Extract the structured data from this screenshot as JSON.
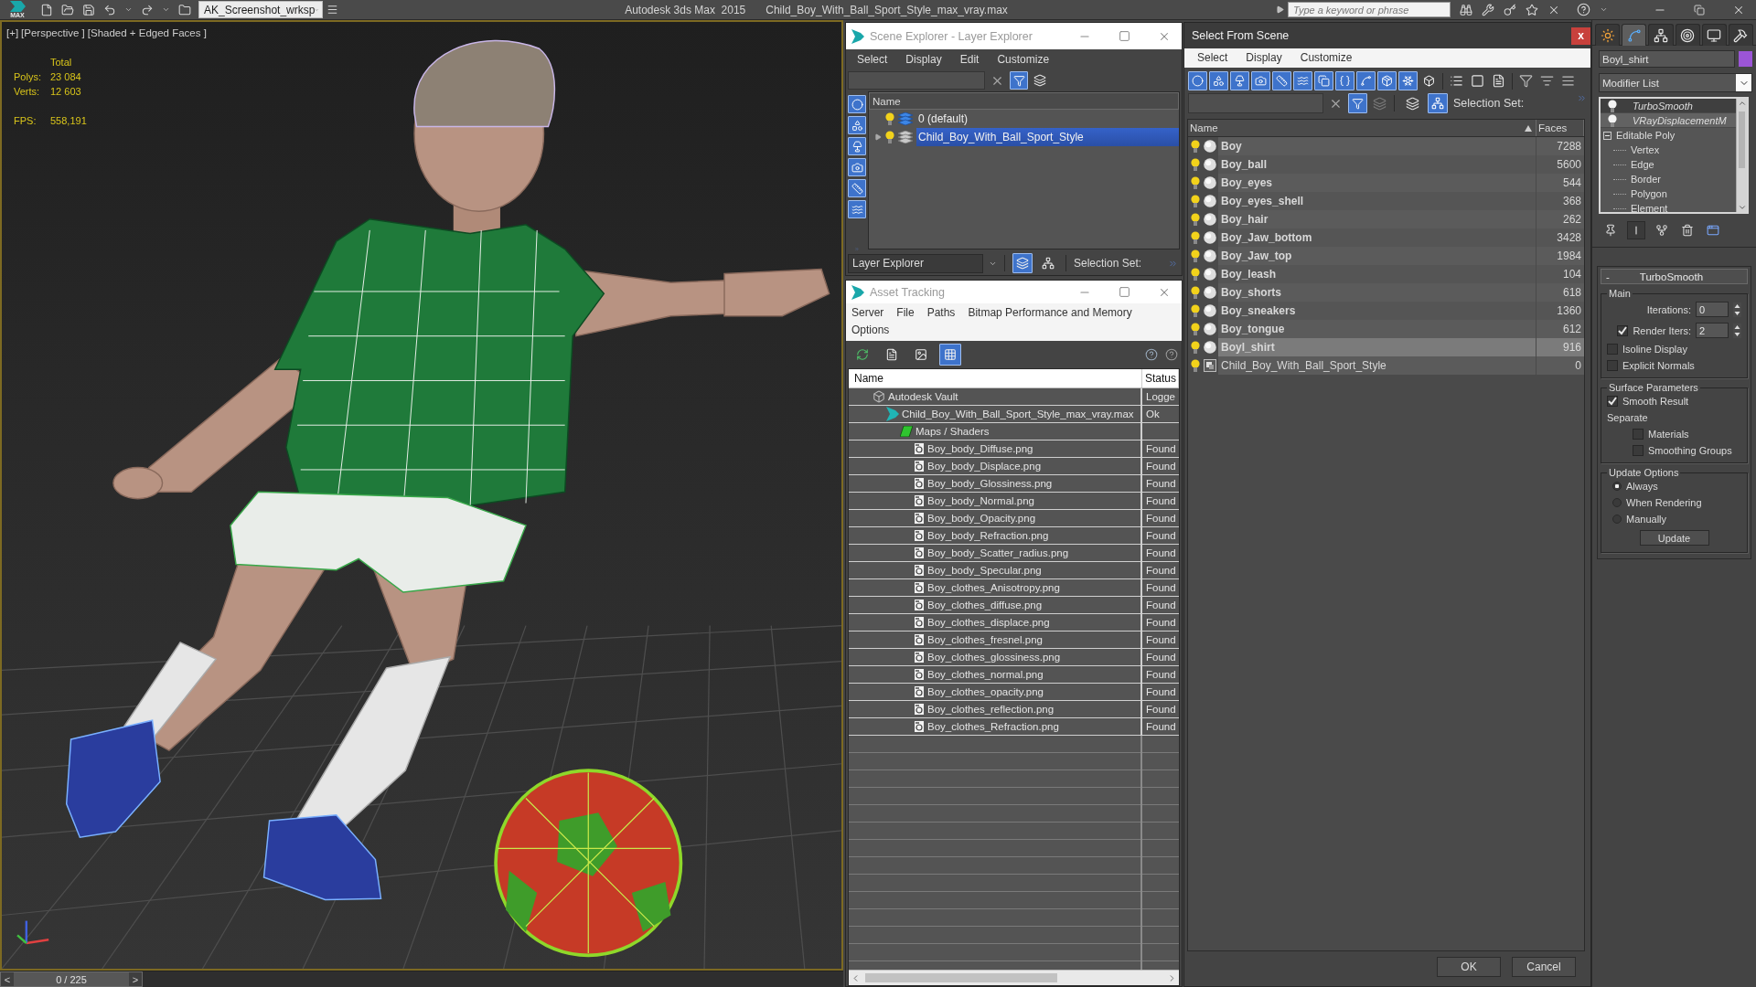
{
  "title_bar": {
    "logo": "MAX",
    "workspace": "AK_Screenshot_wrksp",
    "app_title": "Autodesk 3ds Max  2015",
    "file_title": "Child_Boy_With_Ball_Sport_Style_max_vray.max",
    "search": {
      "placeholder": "Type a keyword or phrase"
    }
  },
  "viewport": {
    "labels": [
      "[+]",
      "[Perspective ]",
      "[Shaded + Edged Faces ]"
    ],
    "stats_heading": "Total",
    "counts": [
      {
        "label": "Polys:",
        "value": "23 084"
      },
      {
        "label": "Verts:",
        "value": "12 603"
      }
    ],
    "fps": {
      "label": "FPS:",
      "value": "558,191"
    }
  },
  "timeline": {
    "previous": "<",
    "frame": "0 / 225",
    "next": ">",
    "level": 0
  },
  "scene_explorer": {
    "title": "Scene Explorer - Layer Explorer",
    "menu": [
      "Select",
      "Display",
      "Edit",
      "Customize"
    ],
    "filter_active": true,
    "type_filters": [
      {
        "on": true
      },
      {
        "on": true
      },
      {
        "on": true
      },
      {
        "on": true
      },
      {
        "on": true
      },
      {
        "on": true
      }
    ],
    "column": "Name",
    "layers": [
      {
        "name": "0 (default)",
        "current": true,
        "expandable": false,
        "selected": false
      },
      {
        "name": "Child_Boy_With_Ball_Sport_Style",
        "current": false,
        "expandable": true,
        "selected": true
      }
    ],
    "mode": "Layer Explorer",
    "view_buttons": [
      {
        "selected": true
      },
      {
        "selected": false
      }
    ],
    "selection_set": "Selection Set:"
  },
  "asset_tracking": {
    "title": "Asset Tracking",
    "menu": [
      "Server",
      "File",
      "Paths",
      "Bitmap Performance and Memory",
      "Options"
    ],
    "view_buttons": [
      {
        "selected": false
      },
      {
        "selected": false
      },
      {
        "selected": false
      },
      {
        "selected": true
      }
    ],
    "columns": [
      "Name",
      "Status"
    ],
    "assets": [
      {
        "kind": "vault",
        "name": "Autodesk Vault",
        "status": "Logge",
        "children": [
          {
            "kind": "scene",
            "name": "Child_Boy_With_Ball_Sport_Style_max_vray.max",
            "status": "Ok",
            "children": [
              {
                "kind": "folder",
                "name": "Maps / Shaders",
                "children": [
                  {
                    "kind": "bitmap",
                    "name": "Boy_body_Diffuse.png",
                    "status": "Found"
                  },
                  {
                    "kind": "bitmap",
                    "name": "Boy_body_Displace.png",
                    "status": "Found"
                  },
                  {
                    "kind": "bitmap",
                    "name": "Boy_body_Glossiness.png",
                    "status": "Found"
                  },
                  {
                    "kind": "bitmap",
                    "name": "Boy_body_Normal.png",
                    "status": "Found"
                  },
                  {
                    "kind": "bitmap",
                    "name": "Boy_body_Opacity.png",
                    "status": "Found"
                  },
                  {
                    "kind": "bitmap",
                    "name": "Boy_body_Refraction.png",
                    "status": "Found"
                  },
                  {
                    "kind": "bitmap",
                    "name": "Boy_body_Scatter_radius.png",
                    "status": "Found"
                  },
                  {
                    "kind": "bitmap",
                    "name": "Boy_body_Specular.png",
                    "status": "Found"
                  },
                  {
                    "kind": "bitmap",
                    "name": "Boy_clothes_Anisotropy.png",
                    "status": "Found"
                  },
                  {
                    "kind": "bitmap",
                    "name": "Boy_clothes_diffuse.png",
                    "status": "Found"
                  },
                  {
                    "kind": "bitmap",
                    "name": "Boy_clothes_displace.png",
                    "status": "Found"
                  },
                  {
                    "kind": "bitmap",
                    "name": "Boy_clothes_fresnel.png",
                    "status": "Found"
                  },
                  {
                    "kind": "bitmap",
                    "name": "Boy_clothes_glossiness.png",
                    "status": "Found"
                  },
                  {
                    "kind": "bitmap",
                    "name": "Boy_clothes_normal.png",
                    "status": "Found"
                  },
                  {
                    "kind": "bitmap",
                    "name": "Boy_clothes_opacity.png",
                    "status": "Found"
                  },
                  {
                    "kind": "bitmap",
                    "name": "Boy_clothes_reflection.png",
                    "status": "Found"
                  },
                  {
                    "kind": "bitmap",
                    "name": "Boy_clothes_Refraction.png",
                    "status": "Found"
                  }
                ]
              }
            ]
          }
        ]
      }
    ]
  },
  "select_from_scene": {
    "title": "Select From Scene",
    "close": "x",
    "menu": [
      "Select",
      "Display",
      "Customize"
    ],
    "type_filters": [
      {
        "on": true
      },
      {
        "on": true
      },
      {
        "on": true
      },
      {
        "on": true
      },
      {
        "on": true
      },
      {
        "on": true
      },
      {
        "on": true
      },
      {
        "on": true
      },
      {
        "on": true
      },
      {
        "on": true
      },
      {
        "on": true
      },
      {
        "on": false
      }
    ],
    "filter_active": true,
    "view_buttons": [
      {
        "selected": false
      },
      {
        "selected": true
      }
    ],
    "selection_set": "Selection Set:",
    "columns": [
      "Name",
      "Faces"
    ],
    "objects": [
      {
        "kind": "geometry",
        "name": "Boy",
        "faces": "7288",
        "selected": false
      },
      {
        "kind": "geometry",
        "name": "Boy_ball",
        "faces": "5600",
        "selected": false
      },
      {
        "kind": "geometry",
        "name": "Boy_eyes",
        "faces": "544",
        "selected": false
      },
      {
        "kind": "geometry",
        "name": "Boy_eyes_shell",
        "faces": "368",
        "selected": false
      },
      {
        "kind": "geometry",
        "name": "Boy_hair",
        "faces": "262",
        "selected": false
      },
      {
        "kind": "geometry",
        "name": "Boy_Jaw_bottom",
        "faces": "3428",
        "selected": false
      },
      {
        "kind": "geometry",
        "name": "Boy_Jaw_top",
        "faces": "1984",
        "selected": false
      },
      {
        "kind": "geometry",
        "name": "Boy_leash",
        "faces": "104",
        "selected": false
      },
      {
        "kind": "geometry",
        "name": "Boy_shorts",
        "faces": "618",
        "selected": false
      },
      {
        "kind": "geometry",
        "name": "Boy_sneakers",
        "faces": "1360",
        "selected": false
      },
      {
        "kind": "geometry",
        "name": "Boy_tongue",
        "faces": "612",
        "selected": false
      },
      {
        "kind": "geometry",
        "name": "Boyl_shirt",
        "faces": "916",
        "selected": true
      },
      {
        "kind": "group",
        "name": "Child_Boy_With_Ball_Sport_Style",
        "faces": "0",
        "selected": false
      }
    ],
    "buttons": [
      "OK",
      "Cancel"
    ]
  },
  "command_panel": {
    "tabs": [
      {
        "selected": false
      },
      {
        "selected": true
      },
      {
        "selected": false
      },
      {
        "selected": false
      },
      {
        "selected": false
      },
      {
        "selected": false
      }
    ],
    "object": {
      "name": "Boyl_shirt",
      "color": "#9b55d6"
    },
    "modifier_list": "Modifier List",
    "stack": [
      {
        "kind": "modifier",
        "name": "TurboSmooth",
        "selected": true
      },
      {
        "kind": "modifier",
        "name": "VRayDisplacementM",
        "selected": false
      },
      {
        "kind": "base",
        "name": "Editable Poly",
        "selected": false,
        "expanded": true,
        "children": [
          {
            "name": "Vertex",
            "selected": false
          },
          {
            "name": "Edge",
            "selected": false
          },
          {
            "name": "Border",
            "selected": false
          },
          {
            "name": "Polygon",
            "selected": false
          },
          {
            "name": "Element",
            "selected": false
          }
        ]
      }
    ],
    "stack_tools": [
      {
        "on": false
      },
      {
        "on": true
      },
      {
        "on": false
      },
      {
        "on": false
      },
      {
        "on": false
      }
    ],
    "rollout": {
      "toggle": "-",
      "title": "TurboSmooth",
      "groups": [
        {
          "title": "Main",
          "controls": [
            {
              "kind": "spinner",
              "label": "Iterations:",
              "value": "0"
            },
            {
              "kind": "checked_spinner",
              "label": "Render Iters:",
              "value": "2",
              "checked": true
            },
            {
              "kind": "checkbox",
              "label": "Isoline Display",
              "checked": false
            },
            {
              "kind": "checkbox",
              "label": "Explicit Normals",
              "checked": false
            }
          ]
        },
        {
          "title": "Surface Parameters",
          "controls": [
            {
              "kind": "checkbox",
              "label": "Smooth Result",
              "checked": true
            },
            {
              "kind": "label",
              "label": "Separate",
              "children": [
                {
                  "kind": "checkbox",
                  "label": "Materials",
                  "checked": false
                },
                {
                  "kind": "checkbox",
                  "label": "Smoothing Groups",
                  "checked": false
                }
              ]
            }
          ]
        },
        {
          "title": "Update Options",
          "controls": [
            {
              "kind": "radio",
              "label": "Always",
              "selected": true
            },
            {
              "kind": "radio",
              "label": "When Rendering",
              "selected": false
            },
            {
              "kind": "radio",
              "label": "Manually",
              "selected": false
            },
            {
              "kind": "button",
              "label": "Update"
            }
          ]
        }
      ]
    }
  }
}
